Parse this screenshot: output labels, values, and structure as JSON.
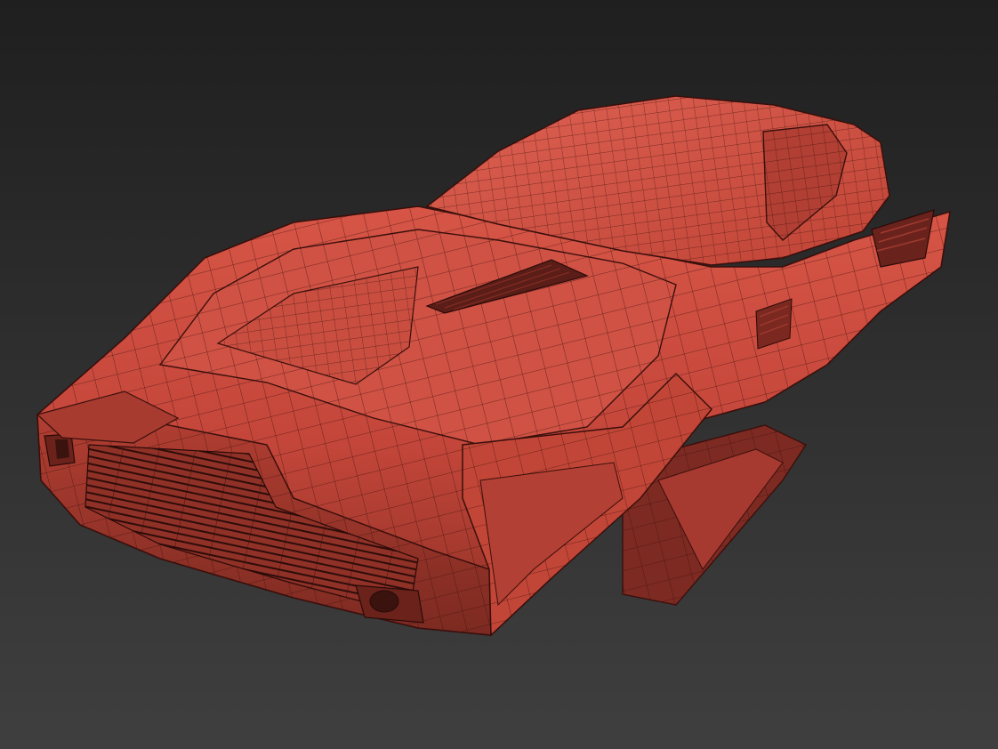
{
  "viewport": {
    "background_top": "#1f1f1f",
    "background_bottom": "#3f3f3f"
  },
  "model": {
    "kind": "hover-car-wireframe",
    "shaded_color": "#c8483a",
    "shadow_color": "#7a2820",
    "highlight_color": "#e2675a",
    "wire_color": "#3a0f0c"
  }
}
